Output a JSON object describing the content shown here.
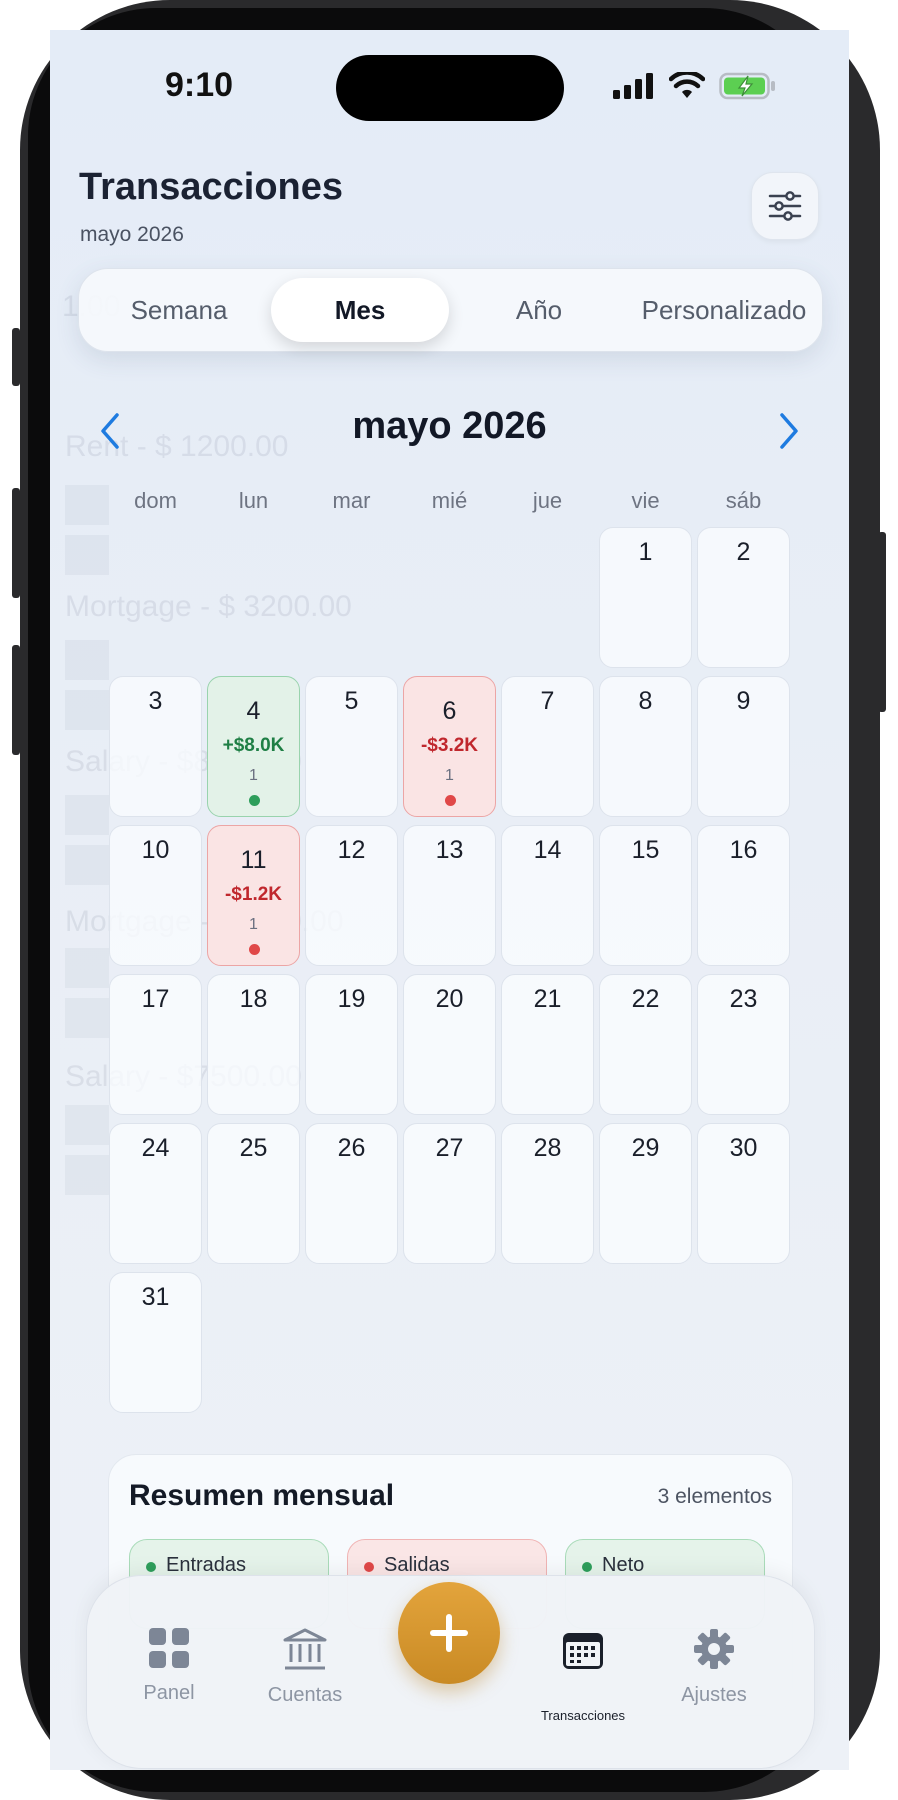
{
  "status_bar": {
    "time": "9:10"
  },
  "header": {
    "title": "Transacciones",
    "subtitle": "mayo 2026"
  },
  "segments": [
    {
      "label": "Semana"
    },
    {
      "label": "Mes"
    },
    {
      "label": "Año"
    },
    {
      "label": "Personalizado"
    }
  ],
  "selected_segment": "Mes",
  "calendar": {
    "month_title": "mayo 2026",
    "weekdays": [
      "dom",
      "lun",
      "mar",
      "mié",
      "jue",
      "vie",
      "sáb"
    ],
    "days": [
      {
        "day": "1"
      },
      {
        "day": "2"
      },
      {
        "day": "3"
      },
      {
        "day": "4",
        "amount": "+$8.0K",
        "count": "1",
        "status": "income"
      },
      {
        "day": "5"
      },
      {
        "day": "6",
        "amount": "-$3.2K",
        "count": "1",
        "status": "expense"
      },
      {
        "day": "7"
      },
      {
        "day": "8"
      },
      {
        "day": "9"
      },
      {
        "day": "10"
      },
      {
        "day": "11",
        "amount": "-$1.2K",
        "count": "1",
        "status": "expense"
      },
      {
        "day": "12"
      },
      {
        "day": "13"
      },
      {
        "day": "14"
      },
      {
        "day": "15"
      },
      {
        "day": "16"
      },
      {
        "day": "17"
      },
      {
        "day": "18"
      },
      {
        "day": "19"
      },
      {
        "day": "20"
      },
      {
        "day": "21"
      },
      {
        "day": "22"
      },
      {
        "day": "23"
      },
      {
        "day": "24"
      },
      {
        "day": "25"
      },
      {
        "day": "26"
      },
      {
        "day": "27"
      },
      {
        "day": "28"
      },
      {
        "day": "29"
      },
      {
        "day": "30"
      },
      {
        "day": "31"
      }
    ]
  },
  "background_ghost": {
    "items": [
      "1.00",
      "Rent - $ 1200.00",
      "Mortgage - $ 3200.00",
      "Salary - $8000.00",
      "Mortgage - $1200.00",
      "Salary - $7500.00"
    ]
  },
  "summary": {
    "title": "Resumen mensual",
    "count_label": "3 elementos",
    "chips": [
      {
        "label": "Entradas",
        "color": "#2e9e5b"
      },
      {
        "label": "Salidas",
        "color": "#e04848"
      },
      {
        "label": "Neto",
        "color": "#2e9e5b"
      }
    ]
  },
  "tab_bar": {
    "tabs": [
      {
        "label": "Panel",
        "icon": "grid-icon"
      },
      {
        "label": "Cuentas",
        "icon": "bank-icon"
      },
      {
        "label": "Transacciones",
        "icon": "calendar-icon",
        "active": true
      },
      {
        "label": "Ajustes",
        "icon": "gear-icon"
      }
    ],
    "add_icon": "plus-icon"
  },
  "colors": {
    "accent_blue": "#1e7be0",
    "income_green": "#1f7f45",
    "expense_red": "#c0272d",
    "add_button": "#d79a30"
  }
}
